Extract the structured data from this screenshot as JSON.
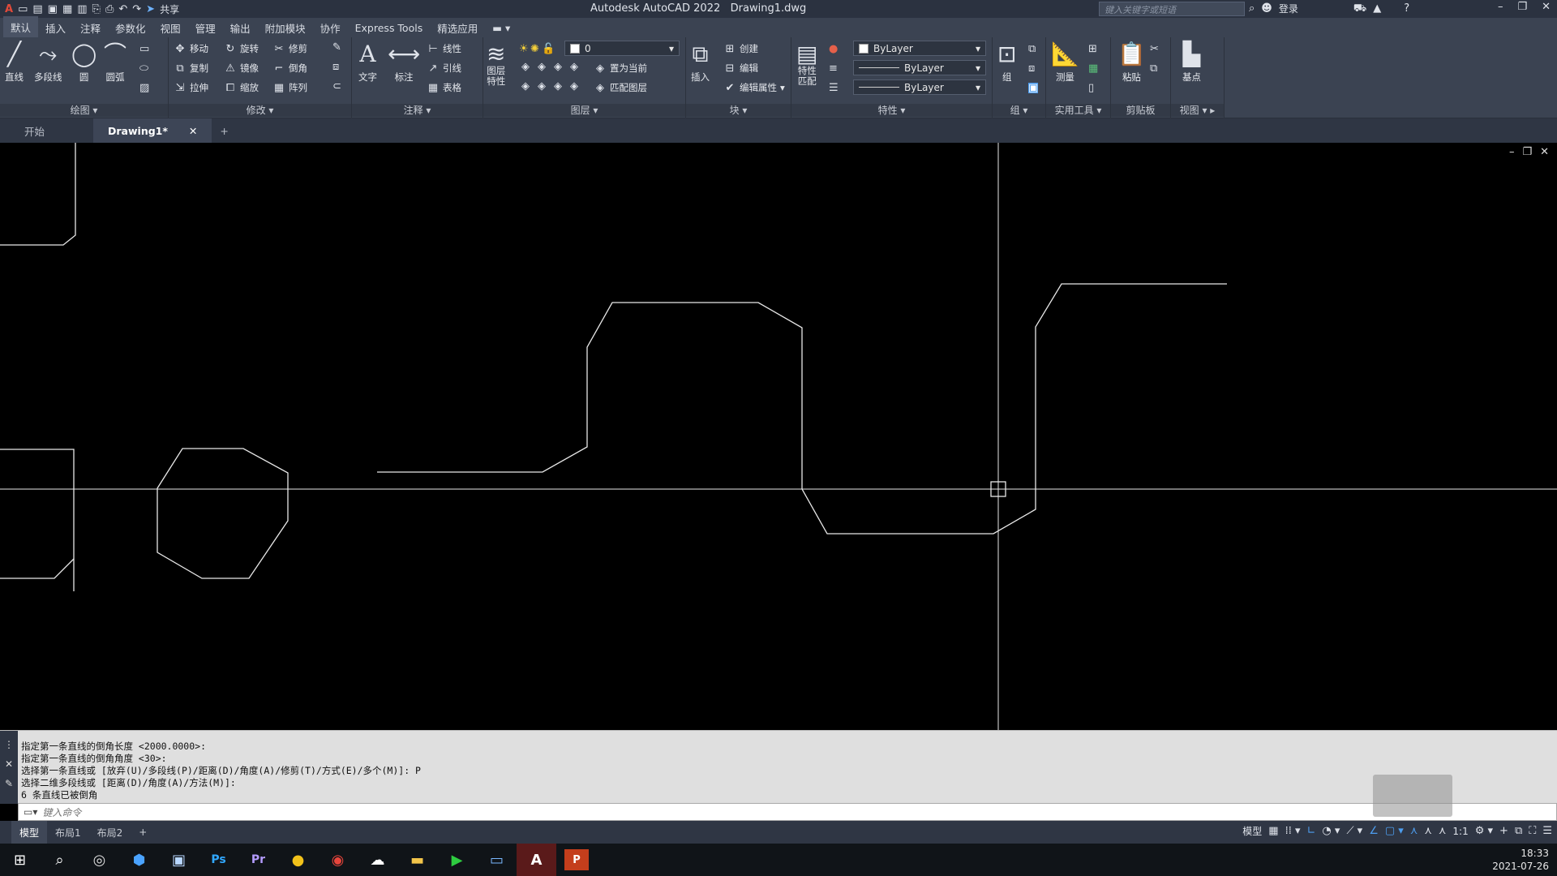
{
  "titlebar": {
    "app_title": "Autodesk AutoCAD 2022",
    "doc_name": "Drawing1.dwg",
    "share_label": "共享",
    "search_placeholder": "键入关键字或短语",
    "login_label": "登录"
  },
  "menu_tabs": [
    "默认",
    "插入",
    "注释",
    "参数化",
    "视图",
    "管理",
    "输出",
    "附加模块",
    "协作",
    "Express Tools",
    "精选应用"
  ],
  "ribbon": {
    "draw": {
      "label": "绘图",
      "line": "直线",
      "polyline": "多段线",
      "circle": "圆",
      "arc": "圆弧"
    },
    "modify": {
      "label": "修改",
      "move": "移动",
      "rotate": "旋转",
      "trim": "修剪",
      "copy": "复制",
      "mirror": "镜像",
      "fillet": "倒角",
      "stretch": "拉伸",
      "scale": "缩放",
      "array": "阵列"
    },
    "annotation": {
      "label": "注释",
      "text": "文字",
      "dimension": "标注",
      "linear": "线性",
      "leader": "引线",
      "table": "表格"
    },
    "layers": {
      "label": "图层",
      "properties": "图层\n特性",
      "layer_value": "0",
      "set_current": "置为当前",
      "match_layer": "匹配图层"
    },
    "block": {
      "label": "块",
      "insert": "插入",
      "create": "创建",
      "edit": "编辑",
      "edit_attr": "编辑属性"
    },
    "properties": {
      "label": "特性",
      "match": "特性\n匹配",
      "color": "ByLayer",
      "linetype": "ByLayer",
      "lineweight": "ByLayer"
    },
    "groups": {
      "label": "组",
      "group": "组"
    },
    "utilities": {
      "label": "实用工具",
      "measure": "测量"
    },
    "clipboard": {
      "label": "剪贴板",
      "paste": "粘贴"
    },
    "view": {
      "label": "视图",
      "base": "基点"
    }
  },
  "doc_tabs": {
    "start": "开始",
    "drawing": "Drawing1*"
  },
  "command": {
    "history": [
      "指定第一条直线的倒角长度 <2000.0000>:",
      "指定第一条直线的倒角角度 <30>:",
      "选择第一条直线或 [放弃(U)/多段线(P)/距离(D)/角度(A)/修剪(T)/方式(E)/多个(M)]: P",
      "选择二维多段线或 [距离(D)/角度(A)/方法(M)]:",
      "6 条直线已被倒角"
    ],
    "input_placeholder": "键入命令"
  },
  "layout_tabs": [
    "模型",
    "布局1",
    "布局2"
  ],
  "status": {
    "model": "模型",
    "scale": "1:1"
  },
  "clock": {
    "time": "18:33",
    "date": "2021-07-26"
  },
  "colors": {
    "accent": "#4d9ef0",
    "canvas": "#000000",
    "ribbon": "#3b4352"
  }
}
